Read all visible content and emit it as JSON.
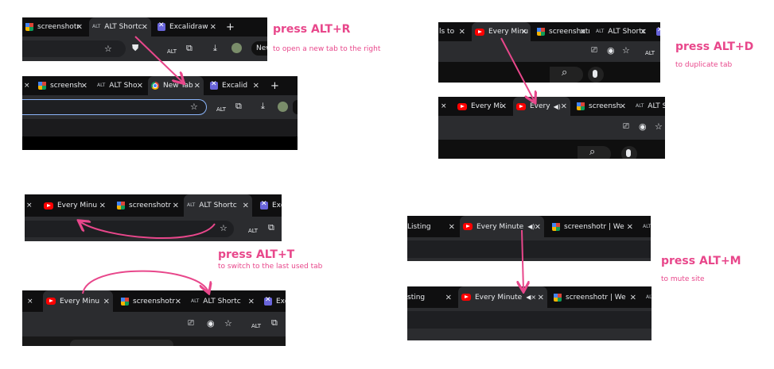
{
  "annotations": {
    "alt_r": {
      "title": "press ALT+R",
      "desc": "to open a new tab to the right"
    },
    "alt_d": {
      "title": "press ALT+D",
      "desc": "to duplicate tab"
    },
    "alt_t": {
      "title": "press ALT+T",
      "desc": "to switch to the last used tab"
    },
    "alt_m": {
      "title": "press ALT+M",
      "desc": "to mute site"
    }
  },
  "shots": {
    "r_before": {
      "tabs": [
        "screenshotr",
        "ALT Shortc",
        "Excalidraw"
      ],
      "new_tab": "+",
      "profile": "New"
    },
    "r_after": {
      "tabs": [
        "screensh",
        "ALT Sho",
        "New Tab",
        "Excalid"
      ],
      "new_tab": "+"
    },
    "d_before": {
      "tabs": [
        "ls to",
        "Every Minu",
        "screenshotr",
        "ALT Shortc"
      ]
    },
    "d_after": {
      "tabs": [
        "Every Mi",
        "Every",
        "screensh",
        "ALT S"
      ]
    },
    "t_before": {
      "tabs": [
        "Every Minu",
        "screenshotr",
        "ALT Shortc",
        "Exc"
      ]
    },
    "t_after": {
      "tabs": [
        "Every Minu",
        "screenshotr",
        "ALT Shortc",
        "Exc"
      ]
    },
    "m_before": {
      "tabs": [
        "Listing",
        "Every Minute",
        "screenshotr | We"
      ]
    },
    "m_after": {
      "tabs": [
        "sting",
        "Every Minute",
        "screenshotr | We"
      ]
    }
  },
  "icons": {
    "close": "×",
    "star": "☆",
    "download": "⤓",
    "extensions": "⧉",
    "speaker": "🔊",
    "muted": "🔇",
    "eye": "◉",
    "search": "⌕",
    "mic": "🎤",
    "alt_badge": "ALT"
  },
  "colors": {
    "accent": "#e8478b",
    "chrome_dark": "#202124",
    "tab_active": "#2b2c2f",
    "omnibox_focus": "#8ab4f8"
  }
}
